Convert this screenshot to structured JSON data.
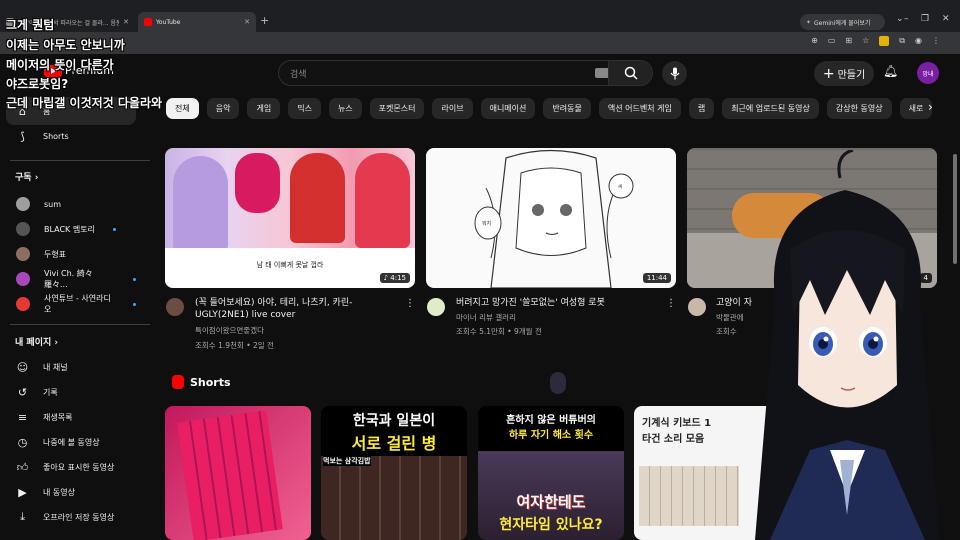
{
  "browser": {
    "tabs": [
      {
        "label": "고양이가 뒤에서 따라오는 걸 몰라... 음몽멈...",
        "active": false
      },
      {
        "label": "YouTube",
        "active": true
      }
    ],
    "gemini_label": "Gemini에게 물어보기"
  },
  "overlay_captions": [
    "그게 퀀텀",
    "이제는 아무도 안보니까",
    "메이저의 뜻이 다른가",
    "야즈로봇임?",
    "근데 마립갤 이것저것 다올라와"
  ],
  "header": {
    "logo_text": "Premium",
    "search_placeholder": "검색",
    "create_label": "만들기",
    "avatar_text": "망내"
  },
  "chips": [
    "전체",
    "음악",
    "게임",
    "믹스",
    "뉴스",
    "포켓몬스터",
    "라이브",
    "애니메이션",
    "반려동물",
    "액션 어드벤처 게임",
    "랩",
    "최근에 업로드된 동영상",
    "감상한 동영상",
    "새로"
  ],
  "sidebar": {
    "main": [
      {
        "label": "홈",
        "icon": "home-icon"
      },
      {
        "label": "Shorts",
        "icon": "shorts-icon"
      }
    ],
    "subscriptions_title": "구독",
    "subscriptions": [
      {
        "label": "sum",
        "color": "#9e9e9e",
        "new": false
      },
      {
        "label": "BLACK 멤토리",
        "color": "#555555",
        "new": true
      },
      {
        "label": "두형표",
        "color": "#8d6e63",
        "new": false
      },
      {
        "label": "Vivi Ch. 綺々羅々...",
        "color": "#ab47bc",
        "new": true
      },
      {
        "label": "사연튜브 - 사연라디오",
        "color": "#e53935",
        "new": true
      }
    ],
    "you_title": "내 페이지",
    "you": [
      {
        "label": "내 채널",
        "icon": "channel-icon"
      },
      {
        "label": "기록",
        "icon": "history-icon"
      },
      {
        "label": "재생목록",
        "icon": "playlist-icon"
      },
      {
        "label": "나중에 볼 동영상",
        "icon": "watch-later-icon"
      },
      {
        "label": "좋아요 표시한 동영상",
        "icon": "like-icon"
      },
      {
        "label": "내 동영상",
        "icon": "my-videos-icon"
      },
      {
        "label": "오프라인 저장 동영상",
        "icon": "download-icon"
      }
    ]
  },
  "videos": [
    {
      "title": "(꼭 들어보세요) 아야, 테리, 나츠키, 카린- UGLY(2NE1) live cover",
      "channel": "특이점이왔으면좋겠다",
      "meta": "조회수 1.9천회 • 2일 전",
      "duration": "4:15",
      "subtitle": "남 태 이뻐게 못날 껍라"
    },
    {
      "title": "버려지고 망가진 '쓸모없는' 여성형 로봇",
      "channel": "마이너 리뷰 갤러리",
      "meta": "조회수 5.1만회 • 9개월 전",
      "duration": "11:44",
      "bubble1": "씨",
      "bubble2": "뭐지"
    },
    {
      "title": "고양이 자",
      "channel": "박물관에",
      "meta": "조회수",
      "duration": "4"
    }
  ],
  "shorts": {
    "title": "Shorts",
    "items": [
      {
        "line1": "",
        "line2": ""
      },
      {
        "line1": "한국과 일본이",
        "line2": "서로 걸린 병",
        "line3": "먹보는 삼각김밥"
      },
      {
        "line1": "흔하지 않은 버튜버의",
        "line2": "하루 자기 해소 횟수",
        "line3": "여자한테도",
        "line4": "현자타임 있나요?"
      },
      {
        "line1": "기계식 키보드 1",
        "line2": "타건 소리 모음"
      }
    ]
  }
}
